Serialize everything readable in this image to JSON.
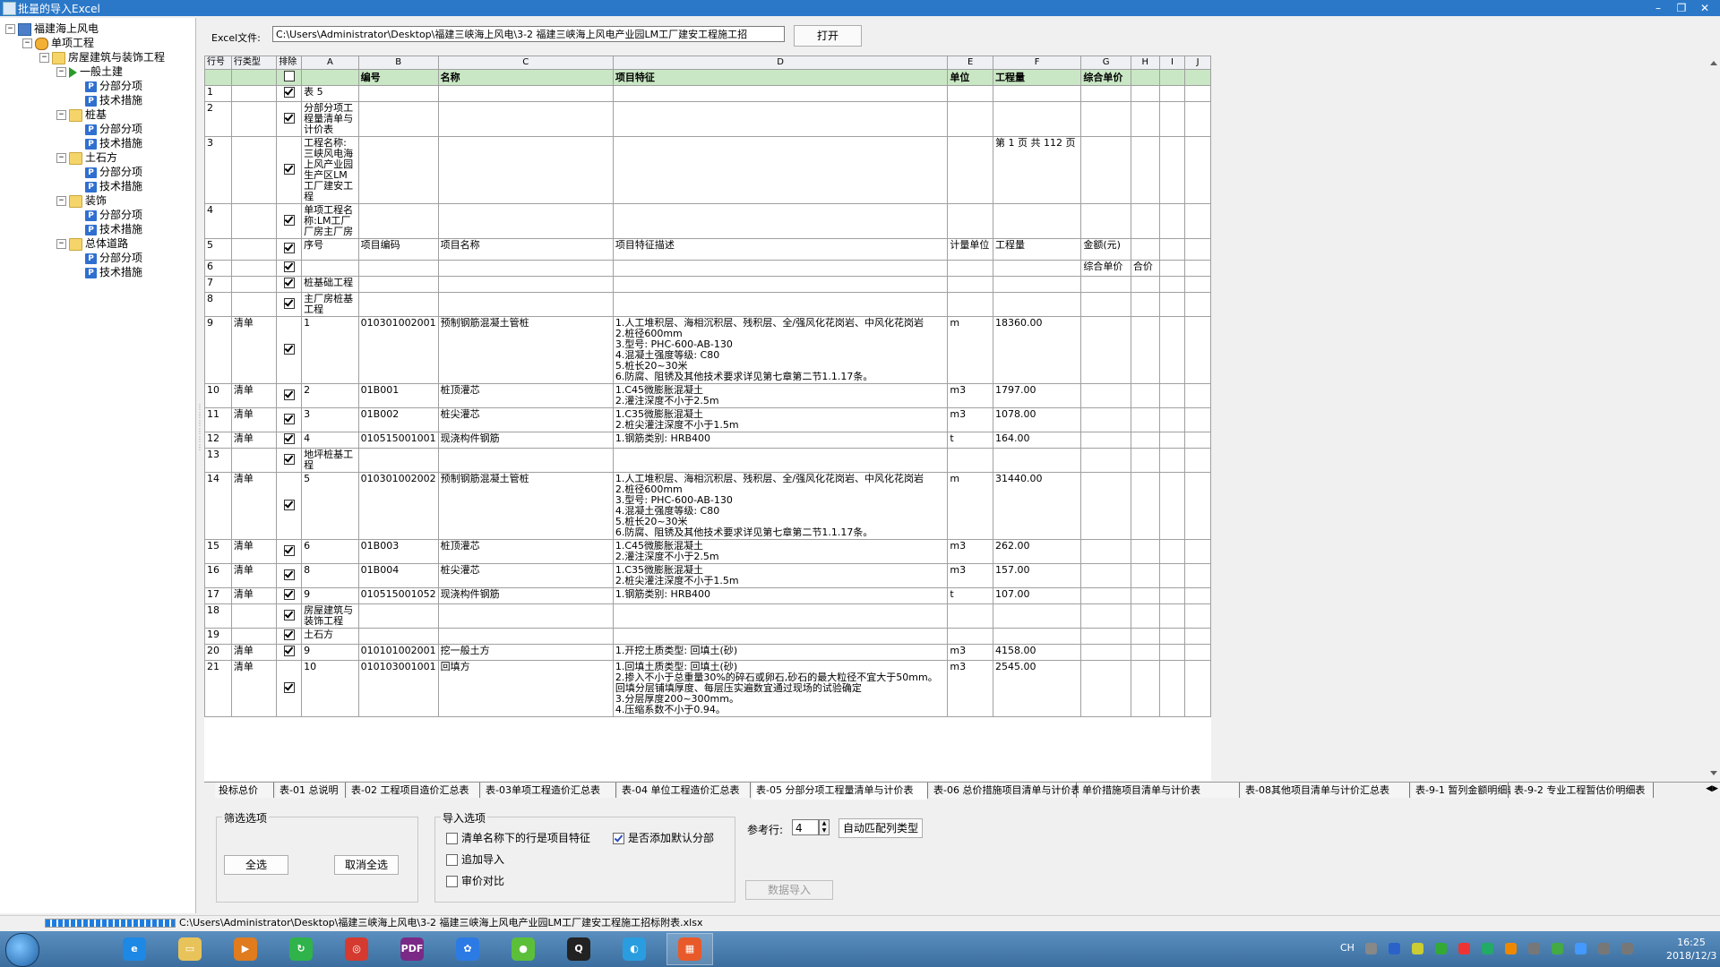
{
  "window": {
    "title": "批量的导入Excel",
    "minimize": "–",
    "restore": "❐",
    "close": "✕"
  },
  "tree": [
    {
      "label": "福建海上风电",
      "icon": "computer-icon"
    },
    {
      "label": "单项工程",
      "icon": "multi-icon"
    },
    {
      "label": "房屋建筑与装饰工程",
      "icon": "folder-icon"
    },
    {
      "label": "一般土建",
      "icon": "arrow-icon"
    },
    {
      "label": "分部分项",
      "icon": "p-file-icon"
    },
    {
      "label": "技术措施",
      "icon": "p-file-icon"
    },
    {
      "label": "桩基",
      "icon": "folder-icon"
    },
    {
      "label": "分部分项",
      "icon": "p-file-icon"
    },
    {
      "label": "技术措施",
      "icon": "p-file-icon"
    },
    {
      "label": "土石方",
      "icon": "folder-icon"
    },
    {
      "label": "分部分项",
      "icon": "p-file-icon"
    },
    {
      "label": "技术措施",
      "icon": "p-file-icon"
    },
    {
      "label": "装饰",
      "icon": "folder-icon"
    },
    {
      "label": "分部分项",
      "icon": "p-file-icon"
    },
    {
      "label": "技术措施",
      "icon": "p-file-icon"
    },
    {
      "label": "总体道路",
      "icon": "folder-icon"
    },
    {
      "label": "分部分项",
      "icon": "p-file-icon"
    },
    {
      "label": "技术措施",
      "icon": "p-file-icon"
    }
  ],
  "excel": {
    "label": "Excel文件:",
    "path": "C:\\Users\\Administrator\\Desktop\\福建三峡海上风电\\3-2 福建三峡海上风电产业园LM工厂建安工程施工招",
    "open_button": "打开"
  },
  "grid": {
    "letter_header": [
      "行号",
      "行类型",
      "排除",
      "A",
      "B",
      "C",
      "D",
      "E",
      "F",
      "G",
      "H",
      "I",
      "J"
    ],
    "name_header": [
      "",
      "",
      "",
      "",
      "编号",
      "名称",
      "项目特征",
      "单位",
      "工程量",
      "综合单价",
      "",
      "",
      ""
    ],
    "rows": [
      {
        "no": "1",
        "type": "",
        "a": "表 5",
        "b": "",
        "c": "",
        "d": "",
        "e": "",
        "f": "",
        "g": "",
        "h": ""
      },
      {
        "no": "2",
        "type": "",
        "a": "分部分项工程量清单与计价表",
        "b": "",
        "c": "",
        "d": "",
        "e": "",
        "f": "",
        "g": "",
        "h": ""
      },
      {
        "no": "3",
        "type": "",
        "a": "工程名称:三峡风电海上风产业园生产区LM工厂建安工程",
        "b": "",
        "c": "",
        "d": "",
        "e": "",
        "f": "第 1 页 共 112 页",
        "g": "",
        "h": ""
      },
      {
        "no": "4",
        "type": "",
        "a": "单项工程名称:LM工厂厂房主厂房",
        "b": "",
        "c": "",
        "d": "",
        "e": "",
        "f": "",
        "g": "",
        "h": ""
      },
      {
        "no": "5",
        "type": "",
        "a": "序号",
        "b": "项目编码",
        "c": "项目名称",
        "d": "项目特征描述",
        "e": "计量单位",
        "f": "工程量",
        "g": "金额(元)",
        "h": ""
      },
      {
        "no": "6",
        "type": "",
        "a": "",
        "b": "",
        "c": "",
        "d": "",
        "e": "",
        "f": "",
        "g": "综合单价",
        "h": "合价"
      },
      {
        "no": "7",
        "type": "",
        "a": "桩基础工程",
        "b": "",
        "c": "",
        "d": "",
        "e": "",
        "f": "",
        "g": "",
        "h": ""
      },
      {
        "no": "8",
        "type": "",
        "a": "主厂房桩基工程",
        "b": "",
        "c": "",
        "d": "",
        "e": "",
        "f": "",
        "g": "",
        "h": ""
      },
      {
        "no": "9",
        "type": "清单",
        "a": "1",
        "b": "010301002001",
        "c": "预制钢筋混凝土管桩",
        "d": "1.人工堆积层、海相沉积层、残积层、全/强风化花岗岩、中风化花岗岩\n2.桩径600mm\n3.型号: PHC-600-AB-130\n4.混凝土强度等级: C80\n5.桩长20~30米\n6.防腐、阻锈及其他技术要求详见第七章第二节1.1.17条。",
        "e": "m",
        "f": "18360.00",
        "g": "",
        "h": ""
      },
      {
        "no": "10",
        "type": "清单",
        "a": "2",
        "b": "01B001",
        "c": "桩顶灌芯",
        "d": "1.C45微膨胀混凝土\n2.灌注深度不小于2.5m",
        "e": "m3",
        "f": "1797.00",
        "g": "",
        "h": ""
      },
      {
        "no": "11",
        "type": "清单",
        "a": "3",
        "b": "01B002",
        "c": "桩尖灌芯",
        "d": "1.C35微膨胀混凝土\n2.桩尖灌注深度不小于1.5m",
        "e": "m3",
        "f": "1078.00",
        "g": "",
        "h": ""
      },
      {
        "no": "12",
        "type": "清单",
        "a": "4",
        "b": "010515001001",
        "c": "现浇构件钢筋",
        "d": "1.钢筋类别: HRB400",
        "e": "t",
        "f": "164.00",
        "g": "",
        "h": ""
      },
      {
        "no": "13",
        "type": "",
        "a": "地坪桩基工程",
        "b": "",
        "c": "",
        "d": "",
        "e": "",
        "f": "",
        "g": "",
        "h": ""
      },
      {
        "no": "14",
        "type": "清单",
        "a": "5",
        "b": "010301002002",
        "c": "预制钢筋混凝土管桩",
        "d": "1.人工堆积层、海相沉积层、残积层、全/强风化花岗岩、中风化花岗岩\n2.桩径600mm\n3.型号: PHC-600-AB-130\n4.混凝土强度等级: C80\n5.桩长20~30米\n6.防腐、阻锈及其他技术要求详见第七章第二节1.1.17条。",
        "e": "m",
        "f": "31440.00",
        "g": "",
        "h": ""
      },
      {
        "no": "15",
        "type": "清单",
        "a": "6",
        "b": "01B003",
        "c": "桩顶灌芯",
        "d": "1.C45微膨胀混凝土\n2.灌注深度不小于2.5m",
        "e": "m3",
        "f": "262.00",
        "g": "",
        "h": ""
      },
      {
        "no": "16",
        "type": "清单",
        "a": "8",
        "b": "01B004",
        "c": "桩尖灌芯",
        "d": "1.C35微膨胀混凝土\n2.桩尖灌注深度不小于1.5m",
        "e": "m3",
        "f": "157.00",
        "g": "",
        "h": ""
      },
      {
        "no": "17",
        "type": "清单",
        "a": "9",
        "b": "010515001052",
        "c": "现浇构件钢筋",
        "d": "1.钢筋类别: HRB400",
        "e": "t",
        "f": "107.00",
        "g": "",
        "h": ""
      },
      {
        "no": "18",
        "type": "",
        "a": "房屋建筑与装饰工程",
        "b": "",
        "c": "",
        "d": "",
        "e": "",
        "f": "",
        "g": "",
        "h": ""
      },
      {
        "no": "19",
        "type": "",
        "a": "土石方",
        "b": "",
        "c": "",
        "d": "",
        "e": "",
        "f": "",
        "g": "",
        "h": ""
      },
      {
        "no": "20",
        "type": "清单",
        "a": "9",
        "b": "010101002001",
        "c": "挖一般土方",
        "d": "1.开挖土质类型: 回填土(砂)",
        "e": "m3",
        "f": "4158.00",
        "g": "",
        "h": ""
      },
      {
        "no": "21",
        "type": "清单",
        "a": "10",
        "b": "010103001001",
        "c": "回填方",
        "d": "1.回填土质类型: 回填土(砂)\n2.掺入不小于总重量30%的碎石或卵石,砂石的最大粒径不宜大于50mm。回填分层铺填厚度、每层压实遍数宜通过现场的试验确定\n3.分层厚度200~300mm。\n4.压缩系数不小于0.94。",
        "e": "m3",
        "f": "2545.00",
        "g": "",
        "h": ""
      }
    ]
  },
  "sheet_tabs": [
    "投标总价",
    "表-01 总说明",
    "表-02 工程项目造价汇总表",
    "表-03单项工程造价汇总表",
    "表-04 单位工程造价汇总表",
    "表-05 分部分项工程量清单与计价表",
    "表-06 总价措施项目清单与计价表",
    "单价措施项目清单与计价表",
    "表-08其他项目清单与计价汇总表",
    "表-9-1 暂列金额明细表",
    "表-9-2 专业工程暂估价明细表"
  ],
  "selected_tab": 5,
  "filter": {
    "title": "筛选选项",
    "select_all": "全选",
    "deselect_all": "取消全选"
  },
  "import": {
    "title": "导入选项",
    "opt_feature": "清单名称下的行是项目特征",
    "opt_append": "追加导入",
    "opt_compare": "审价对比",
    "opt_default_div": "是否添加默认分部",
    "ref_row_label": "参考行:",
    "ref_row_value": "4",
    "auto_match": "自动匹配列类型",
    "import_button": "数据导入"
  },
  "status": {
    "path": "C:\\Users\\Administrator\\Desktop\\福建三峡海上风电\\3-2 福建三峡海上风电产业园LM工厂建安工程施工招标附表.xlsx",
    "progress": 1.0
  },
  "taskbar": {
    "apps": [
      "ie-icon",
      "explorer-icon",
      "media-player-icon",
      "browser-360-icon",
      "chrome-like-icon",
      "pdf-icon",
      "baidu-netdisk-icon",
      "wechat-icon",
      "qq-icon",
      "search-browser-icon",
      "import-tool-icon"
    ],
    "app_glyphs": [
      "e",
      "▭",
      "▶",
      "↻",
      "◎",
      "PDF",
      "✿",
      "●",
      "Q",
      "◐",
      "▦"
    ],
    "app_colors": [
      "#1e88e5",
      "#e8c35a",
      "#e07c1e",
      "#2fb34a",
      "#d43a2f",
      "#7a2a86",
      "#2c7be5",
      "#5cbf3a",
      "#222222",
      "#2a9de0",
      "#e85a2a"
    ],
    "tray_lang": "CH",
    "time": "16:25",
    "date": "2018/12/3"
  }
}
